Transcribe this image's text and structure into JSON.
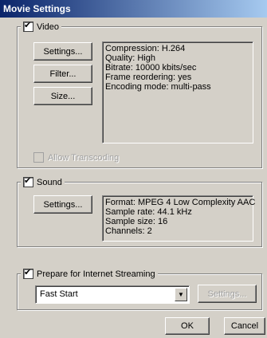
{
  "window": {
    "title": "Movie Settings"
  },
  "video": {
    "label": "Video",
    "checked": true,
    "buttons": {
      "settings": "Settings...",
      "filter": "Filter...",
      "size": "Size..."
    },
    "info": [
      "Compression: H.264",
      "Quality: High",
      "Bitrate: 10000 kbits/sec",
      "Frame reordering: yes",
      "Encoding mode: multi-pass"
    ],
    "allow_transcoding": {
      "label": "Allow Transcoding",
      "checked": false,
      "enabled": false
    }
  },
  "sound": {
    "label": "Sound",
    "checked": true,
    "buttons": {
      "settings": "Settings..."
    },
    "info": [
      "Format: MPEG 4 Low Complexity AAC",
      "Sample rate: 44.1 kHz",
      "Sample size: 16",
      "Channels: 2"
    ]
  },
  "streaming": {
    "label": "Prepare for Internet Streaming",
    "checked": true,
    "selected_option": "Fast Start",
    "settings_label": "Settings..."
  },
  "footer": {
    "ok_label": "OK",
    "cancel_label": "Cancel"
  }
}
